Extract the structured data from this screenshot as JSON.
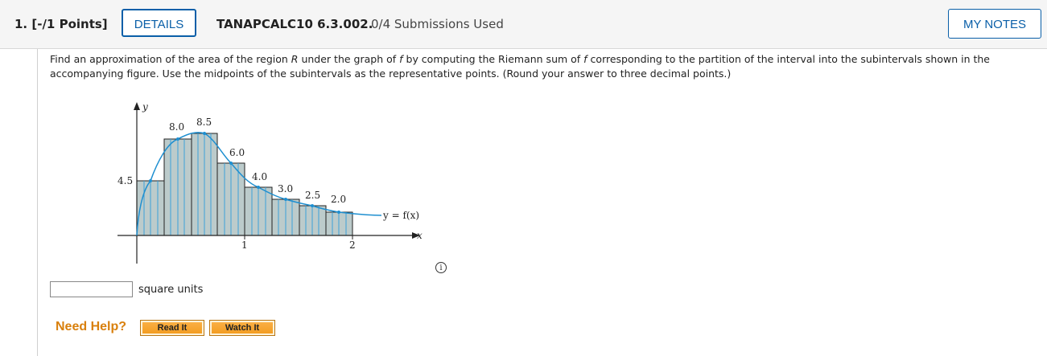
{
  "header": {
    "question_number": "1. [-/1 Points]",
    "details_label": "DETAILS",
    "problem_code": "TANAPCALC10 6.3.002.",
    "submissions": "0/4 Submissions Used",
    "my_notes_label": "MY NOTES"
  },
  "prompt": {
    "part1": "Find an approximation of the area of the region ",
    "var_R": "R",
    "part2": " under the graph of ",
    "var_f1": "f",
    "part3": " by computing the Riemann sum of ",
    "var_f2": "f",
    "part4": " corresponding to the partition of the interval into the subintervals shown in the accompanying figure. Use the midpoints of the subintervals as the representative points. (Round your answer to three decimal points.)"
  },
  "figure": {
    "y_axis_label": "y",
    "x_axis_label": "x",
    "curve_label": "y = f(x)",
    "x_tick_1": "1",
    "x_tick_2": "2",
    "value_labels": [
      "4.5",
      "8.0",
      "8.5",
      "6.0",
      "4.0",
      "3.0",
      "2.5",
      "2.0"
    ],
    "colors": {
      "bar_fill": "#bccbcb",
      "curve": "#1e8fd0",
      "grid_lines": "#3da0d8"
    }
  },
  "answer": {
    "input_value": "",
    "units_label": "square units"
  },
  "help": {
    "label": "Need Help?",
    "read_it": "Read It",
    "watch_it": "Watch It"
  },
  "info_icon_glyph": "i"
}
